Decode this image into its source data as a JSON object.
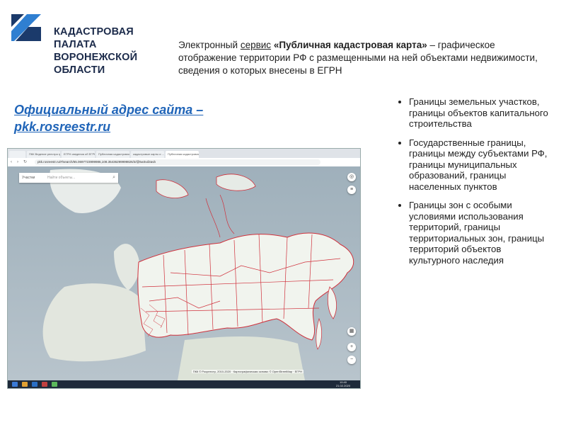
{
  "header": {
    "org_line1": "КАДАСТРОВАЯ ПАЛАТА",
    "org_line2": "ВОРОНЕЖСКОЙ ОБЛАСТИ",
    "logo_color": "#1b3a6b",
    "logo_accent": "#2f7fd1"
  },
  "intro": {
    "part1": "Электронный ",
    "part2": "сервис",
    "part3": " ",
    "part4": "«Публичная кадастровая карта»",
    "part5": " – графическое отображение территории РФ с размещенными на ней объектами недвижимости, сведения о которых внесены в ЕГРН"
  },
  "site": {
    "label": "Официальный адрес сайта –",
    "url": "pkk.rosreestr.ru",
    "color": "#1f64b8"
  },
  "bullets": [
    "Границы земельных участков, границы объектов капитального строительства",
    "Государственные границы, границы между субъектами РФ, границы муниципальных образований, границы населенных пунктов",
    "Границы зон с особыми условиями использования территорий, границы территориальных зон, границы территорий объектов культурного наследия"
  ],
  "screenshot": {
    "tabs": [
      "",
      "ПКК Ведение реестра гра",
      "ЕГРН сведения об ЕГРН",
      "Публичная кадастровая",
      "кадастровые карты и ...",
      "Публичная кадастровая"
    ],
    "url": "pkk.rosreestr.ru/#/search/65.0697723999986,108.35436299999826/3/@5w3vd3avb",
    "search_object_label": "Участки",
    "search_placeholder": "Найти объекты...",
    "search_icon": "magnifier-icon",
    "map_controls": [
      "target-icon",
      "layers-icon",
      "grid-icon",
      "plus-icon",
      "minus-icon"
    ],
    "attribution": "ПКК © Росреестр, 2010-2020 · Картографическая основа: © OpenStreetMap · ЕГРН",
    "clock_time": "10:40",
    "clock_date": "21.02.2020",
    "border_color": "#d0313c"
  }
}
